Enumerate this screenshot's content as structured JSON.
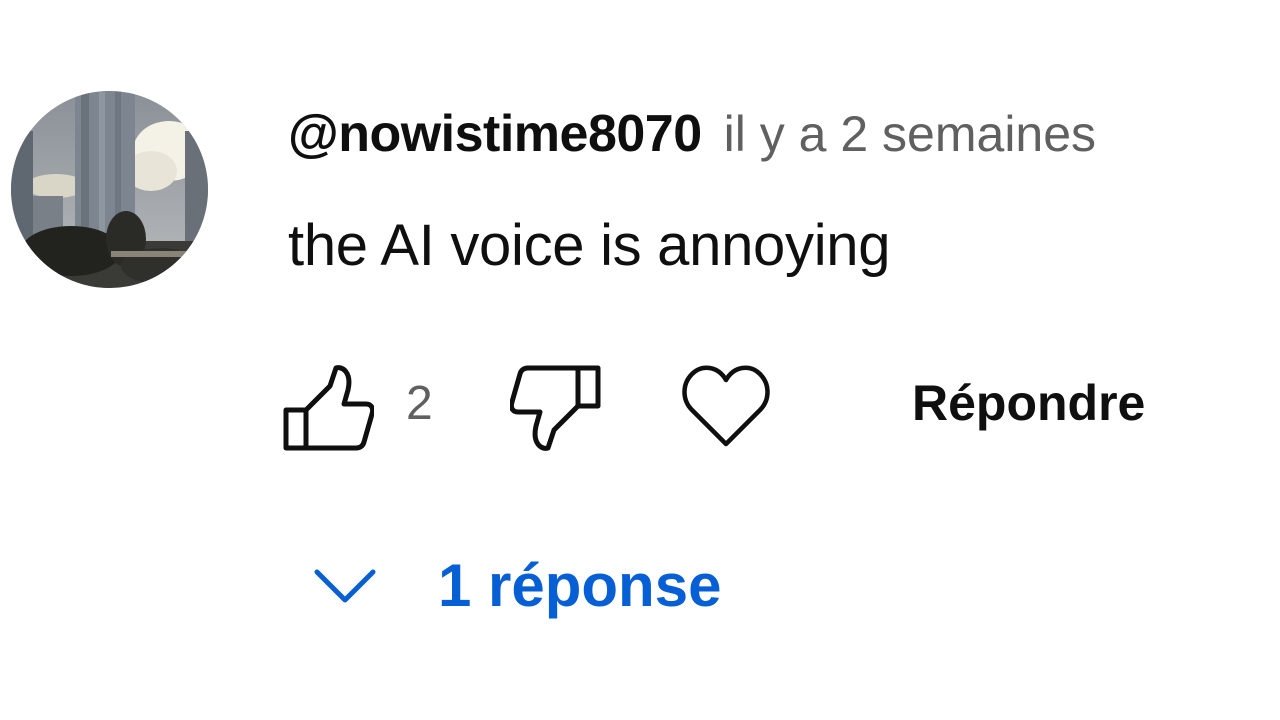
{
  "comment": {
    "author": "@nowistime8070",
    "timestamp": "il y a 2 semaines",
    "text": "the AI voice is annoying",
    "like_count": "2",
    "reply_label": "Répondre",
    "replies_label": "1 réponse"
  },
  "icons": {
    "avatar": "profile-photo",
    "like": "thumbs-up-icon",
    "dislike": "thumbs-down-icon",
    "heart": "heart-icon",
    "expand": "chevron-down-icon"
  },
  "colors": {
    "text": "#0f0f0f",
    "secondary_text": "#606060",
    "link_blue": "#065fd4",
    "background": "#ffffff"
  }
}
